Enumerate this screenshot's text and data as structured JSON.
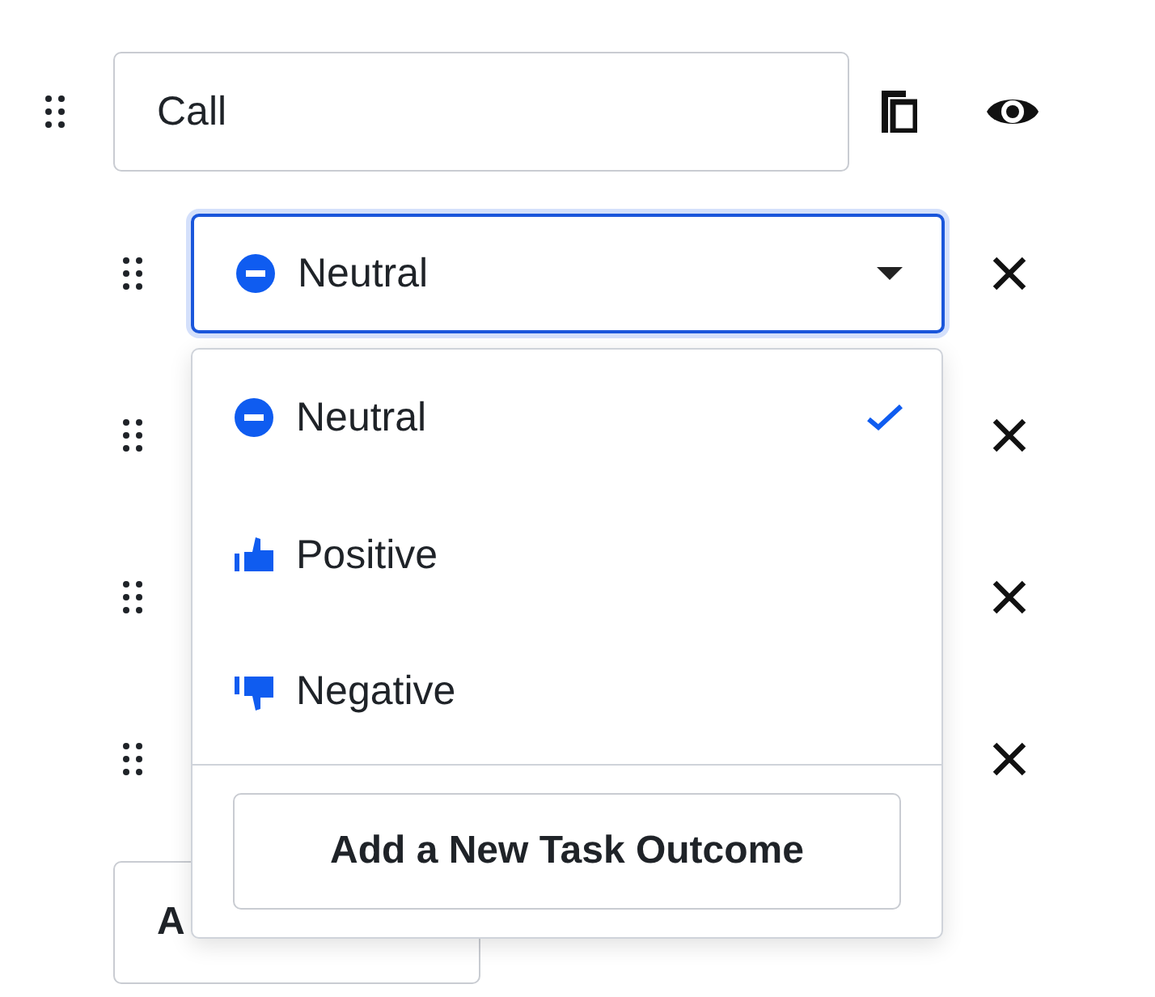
{
  "title_field": {
    "value": "Call"
  },
  "outcome_rows": [
    {
      "kind": "select",
      "value": "Neutral",
      "focused": true
    },
    {
      "kind": "hidden"
    },
    {
      "kind": "hidden"
    },
    {
      "kind": "hidden"
    }
  ],
  "dropdown": {
    "options": [
      {
        "label": "Neutral",
        "selected": true
      },
      {
        "label": "Positive",
        "selected": false
      },
      {
        "label": "Negative",
        "selected": false
      }
    ],
    "action": "Add a New Task Outcome"
  },
  "bottom_button": {
    "label": "A"
  }
}
